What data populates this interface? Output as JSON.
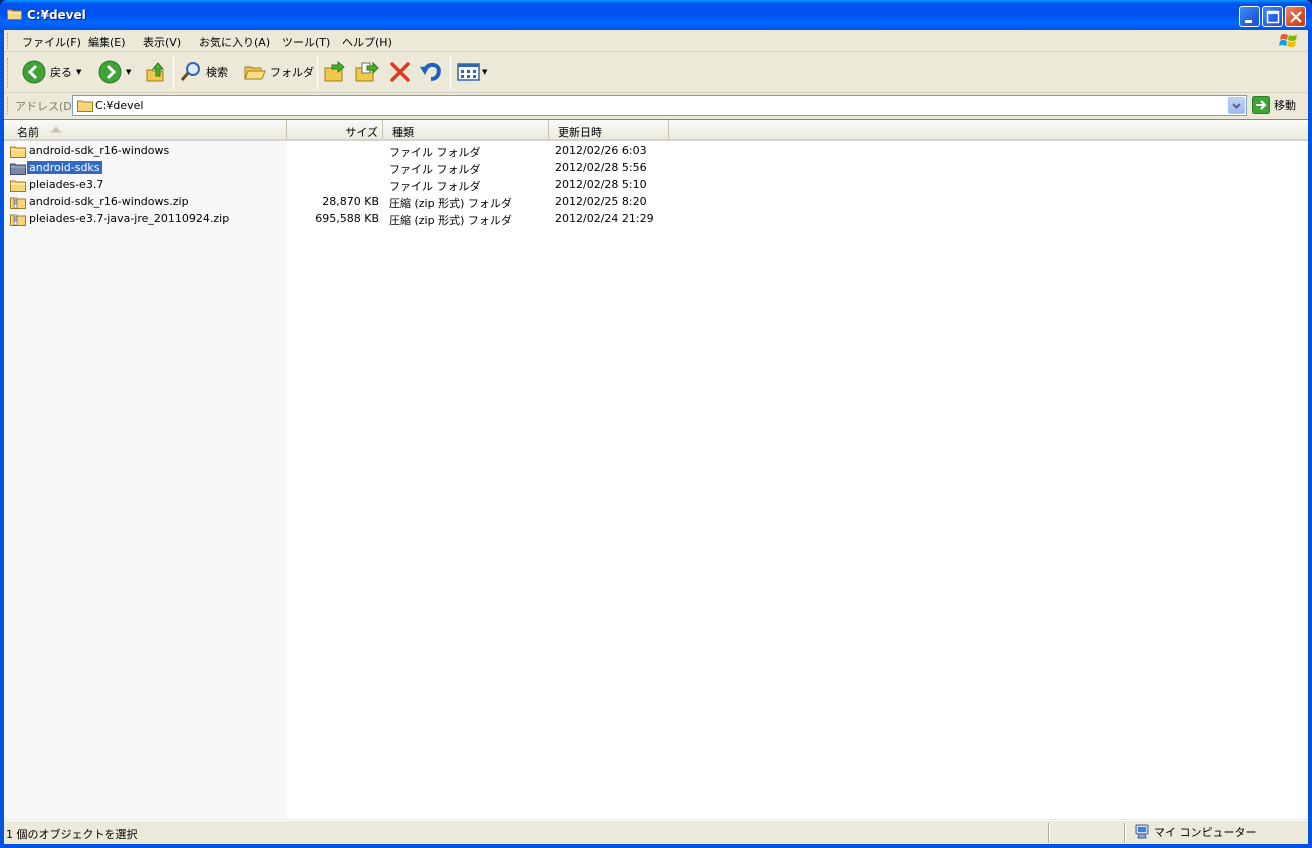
{
  "window": {
    "title": "C:¥devel",
    "colors": {
      "titlebar": "#0054e3",
      "selection": "#316ac5",
      "chrome": "#ece9d8"
    }
  },
  "menu": {
    "file": "ファイル(F)",
    "edit": "編集(E)",
    "view": "表示(V)",
    "favorites": "お気に入り(A)",
    "tools": "ツール(T)",
    "help": "ヘルプ(H)"
  },
  "toolbar": {
    "back_label": "戻る",
    "search_label": "検索",
    "folders_label": "フォルダ",
    "icons": [
      "back-icon",
      "forward-icon",
      "up-icon",
      "search-icon",
      "folders-icon",
      "move-to-icon",
      "copy-to-icon",
      "delete-icon",
      "undo-icon",
      "views-icon"
    ]
  },
  "address": {
    "label": "アドレス(D)",
    "value": "C:¥devel",
    "go_label": "移動"
  },
  "columns": {
    "name": "名前",
    "size": "サイズ",
    "type": "種類",
    "modified": "更新日時"
  },
  "files": [
    {
      "name": "android-sdk_r16-windows",
      "size": "",
      "type": "ファイル フォルダ",
      "modified": "2012/02/26 6:03",
      "icon": "folder-icon",
      "selected": false
    },
    {
      "name": "android-sdks",
      "size": "",
      "type": "ファイル フォルダ",
      "modified": "2012/02/28 5:56",
      "icon": "folder-icon",
      "selected": true
    },
    {
      "name": "pleiades-e3.7",
      "size": "",
      "type": "ファイル フォルダ",
      "modified": "2012/02/28 5:10",
      "icon": "folder-icon",
      "selected": false
    },
    {
      "name": "android-sdk_r16-windows.zip",
      "size": "28,870 KB",
      "type": "圧縮 (zip 形式) フォルダ",
      "modified": "2012/02/25 8:20",
      "icon": "zip-folder-icon",
      "selected": false
    },
    {
      "name": "pleiades-e3.7-java-jre_20110924.zip",
      "size": "695,588 KB",
      "type": "圧縮 (zip 形式) フォルダ",
      "modified": "2012/02/24 21:29",
      "icon": "zip-folder-icon",
      "selected": false
    }
  ],
  "status": {
    "selection_text": "1 個のオブジェクトを選択",
    "location_text": "マイ コンピューター"
  }
}
